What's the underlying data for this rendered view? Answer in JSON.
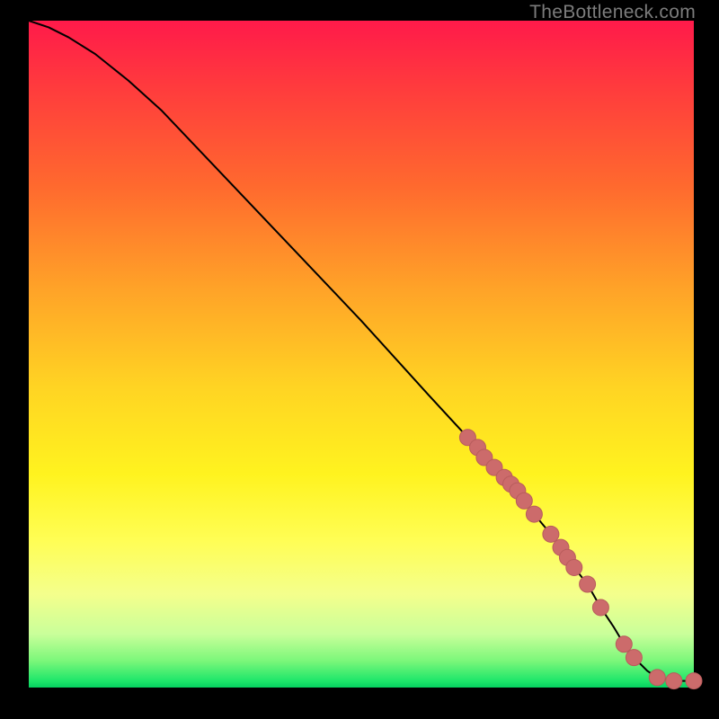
{
  "watermark": "TheBottleneck.com",
  "colors": {
    "marker_fill": "#CC6B6B",
    "marker_stroke": "#B85C5C",
    "line": "#000000"
  },
  "chart_data": {
    "type": "line",
    "title": "",
    "xlabel": "",
    "ylabel": "",
    "xlim": [
      0,
      100
    ],
    "ylim": [
      0,
      100
    ],
    "series": [
      {
        "name": "curve",
        "x": [
          0,
          3,
          6,
          10,
          15,
          20,
          30,
          40,
          50,
          60,
          66,
          68,
          70,
          72,
          73,
          74.5,
          76,
          78.5,
          80,
          81,
          82,
          84,
          86,
          88,
          89.5,
          91,
          93,
          94.5,
          97,
          100
        ],
        "y": [
          100,
          99,
          97.5,
          95,
          91,
          86.5,
          76,
          65.5,
          55,
          44,
          37.5,
          35,
          33,
          31,
          29.5,
          28,
          26,
          23,
          21,
          19.5,
          18,
          15.5,
          12,
          9,
          6.5,
          4.5,
          2.5,
          1.5,
          1,
          1
        ]
      }
    ],
    "markers": {
      "name": "dots",
      "x": [
        66,
        67.5,
        68.5,
        70,
        71.5,
        72.5,
        73.5,
        74.5,
        76,
        78.5,
        80,
        81,
        82,
        84,
        86,
        89.5,
        91,
        94.5,
        97,
        100
      ],
      "y": [
        37.5,
        36,
        34.5,
        33,
        31.5,
        30.5,
        29.5,
        28,
        26,
        23,
        21,
        19.5,
        18,
        15.5,
        12,
        6.5,
        4.5,
        1.5,
        1,
        1
      ]
    }
  }
}
